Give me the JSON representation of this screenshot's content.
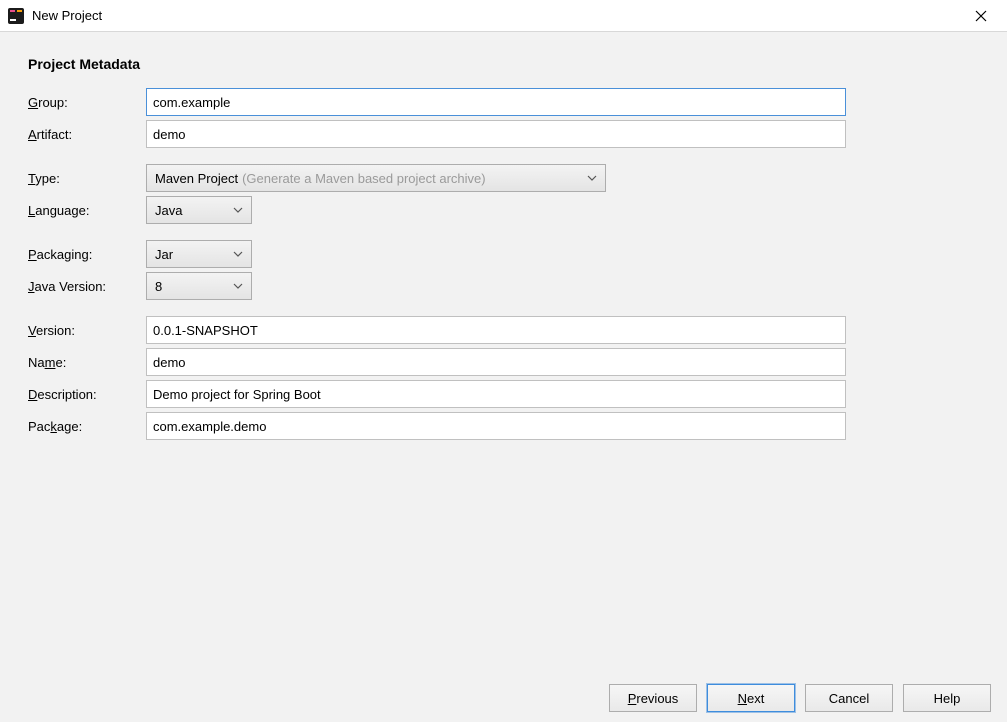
{
  "window": {
    "title": "New Project"
  },
  "heading": "Project Metadata",
  "labels": {
    "group": "Group:",
    "artifact": "Artifact:",
    "type": "Type:",
    "language": "Language:",
    "packaging": "Packaging:",
    "java_version": "Java Version:",
    "version": "Version:",
    "name": "Name:",
    "description": "Description:",
    "package": "Package:"
  },
  "accesskeys": {
    "group": "G",
    "artifact": "A",
    "type": "T",
    "language": "L",
    "packaging": "P",
    "java_version": "J",
    "version": "V",
    "name": "m",
    "description": "D",
    "package": "k"
  },
  "fields": {
    "group": "com.example",
    "artifact": "demo",
    "type": "Maven Project",
    "type_hint": "(Generate a Maven based project archive)",
    "language": "Java",
    "packaging": "Jar",
    "java_version": "8",
    "version": "0.0.1-SNAPSHOT",
    "name": "demo",
    "description": "Demo project for Spring Boot",
    "package": "com.example.demo"
  },
  "buttons": {
    "previous": "Previous",
    "next": "Next",
    "cancel": "Cancel",
    "help": "Help"
  },
  "button_accesskeys": {
    "previous": "P",
    "next": "N"
  }
}
